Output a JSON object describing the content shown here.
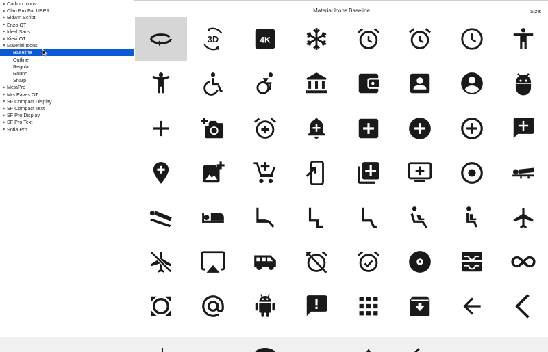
{
  "sidebar": {
    "items": [
      {
        "label": "Carbon Icons",
        "expanded": false
      },
      {
        "label": "Clan Pro For UBER",
        "expanded": false
      },
      {
        "label": "Eldwin Script",
        "expanded": false
      },
      {
        "label": "Enzo OT",
        "expanded": false
      },
      {
        "label": "Ideal Sans",
        "expanded": false
      },
      {
        "label": "KievitOT",
        "expanded": false
      },
      {
        "label": "Material Icons",
        "expanded": true,
        "children": [
          {
            "label": "Baseline",
            "selected": true
          },
          {
            "label": "Outline"
          },
          {
            "label": "Regular"
          },
          {
            "label": "Round"
          },
          {
            "label": "Sharp"
          }
        ]
      },
      {
        "label": "MetaPro",
        "expanded": false
      },
      {
        "label": "Mrs Eaves OT",
        "expanded": false
      },
      {
        "label": "SF Compact Display",
        "expanded": false
      },
      {
        "label": "SF Compact Text",
        "expanded": false
      },
      {
        "label": "SF Pro Display",
        "expanded": false
      },
      {
        "label": "SF Pro Text",
        "expanded": false
      },
      {
        "label": "Sofia Pro",
        "expanded": false
      }
    ]
  },
  "main": {
    "title": "Material Icons Baseline",
    "size_label": "Size:",
    "icons": [
      "rotate-360-icon",
      "3d-rotation-icon",
      "4k-icon",
      "ac-unit-icon",
      "access-alarm-icon",
      "access-alarms-icon",
      "access-time-icon",
      "accessibility-icon",
      "accessibility-new-icon",
      "accessible-icon",
      "accessible-forward-icon",
      "account-balance-icon",
      "account-balance-wallet-icon",
      "account-box-icon",
      "account-circle-icon",
      "adb-icon",
      "add-icon",
      "add-a-photo-icon",
      "add-alarm-icon",
      "add-alert-icon",
      "add-box-icon",
      "add-circle-icon",
      "add-circle-outline-icon",
      "add-comment-icon",
      "add-location-icon",
      "add-photo-alternate-icon",
      "add-shopping-cart-icon",
      "add-to-home-screen-icon",
      "add-to-photos-icon",
      "add-to-queue-icon",
      "adjust-icon",
      "airline-seat-flat-icon",
      "airline-seat-flat-angled-icon",
      "airline-seat-individual-suite-icon",
      "airline-seat-legroom-extra-icon",
      "airline-seat-legroom-normal-icon",
      "airline-seat-legroom-reduced-icon",
      "airline-seat-recline-extra-icon",
      "airline-seat-recline-normal-icon",
      "airplanemode-active-icon",
      "airplanemode-inactive-icon",
      "airplay-icon",
      "airport-shuttle-icon",
      "alarm-off-icon",
      "alarm-on-icon",
      "album-icon",
      "all-inbox-icon",
      "all-inclusive-icon",
      "all-out-icon",
      "alternate-email-icon",
      "android-icon",
      "announcement-icon",
      "apps-icon",
      "archive-icon",
      "arrow-back-icon",
      "arrow-back-ios-icon"
    ],
    "selected_index": 0
  }
}
